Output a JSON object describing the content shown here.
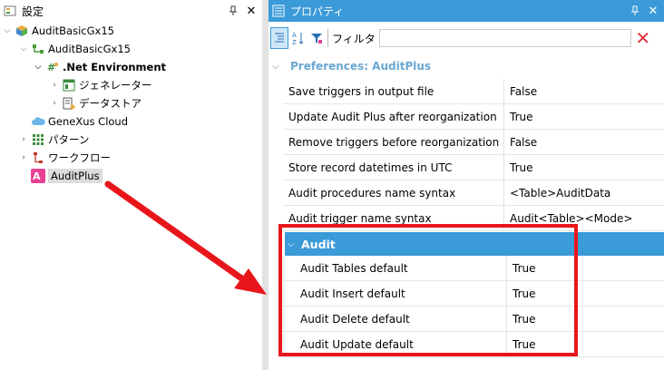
{
  "left_panel": {
    "title": "設定",
    "tree": [
      {
        "label": "AuditBasicGx15",
        "expanded": "true"
      },
      {
        "label": "AuditBasicGx15",
        "expanded": "true"
      },
      {
        "label": ".Net Environment",
        "expanded": "true"
      },
      {
        "label": "ジェネレーター"
      },
      {
        "label": "データストア"
      },
      {
        "label": "GeneXus Cloud"
      },
      {
        "label": "パターン"
      },
      {
        "label": "ワークフロー"
      },
      {
        "label": "AuditPlus",
        "selected": "true"
      }
    ]
  },
  "right_panel": {
    "title": "プロパティ",
    "toolbar": {
      "filter_label": "フィルタ",
      "filter_value": ""
    },
    "section_title": "Preferences: AuditPlus",
    "properties": [
      {
        "name": "Save triggers in output file",
        "value": "False"
      },
      {
        "name": "Update Audit Plus after reorganization",
        "value": "True"
      },
      {
        "name": "Remove triggers before reorganization",
        "value": "False"
      },
      {
        "name": "Store record datetimes in UTC",
        "value": "True"
      },
      {
        "name": "Audit procedures name syntax",
        "value": "<Table>AuditData"
      },
      {
        "name": "Audit trigger name syntax",
        "value": "Audit<Table><Mode>"
      }
    ],
    "group_title": "Audit",
    "group_properties": [
      {
        "name": "Audit Tables default",
        "value": "True"
      },
      {
        "name": "Audit Insert default",
        "value": "True"
      },
      {
        "name": "Audit Delete default",
        "value": "True"
      },
      {
        "name": "Audit Update default",
        "value": "True"
      }
    ]
  },
  "colors": {
    "accent": "#3b9ad8",
    "highlight": "#e8161b",
    "section_text": "#6aa7d2"
  },
  "icons": [
    "settings-icon",
    "pin-icon",
    "close-icon",
    "kb-icon",
    "version-icon",
    "environment-icon",
    "generator-icon",
    "datastore-icon",
    "cloud-icon",
    "pattern-icon",
    "workflow-icon",
    "auditplus-icon",
    "properties-icon",
    "categorized-icon",
    "sort-az-icon",
    "filter-icon",
    "clear-filter-icon"
  ]
}
